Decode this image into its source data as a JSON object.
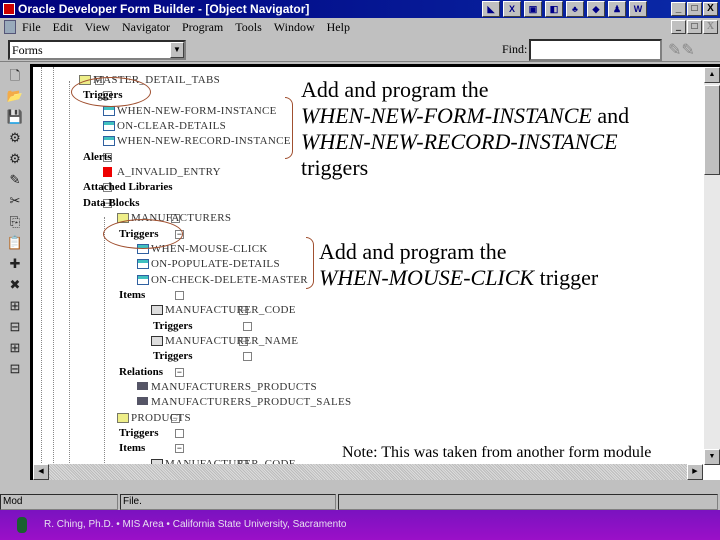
{
  "window": {
    "title": "Oracle Developer Form Builder - [Object Navigator]",
    "controls": [
      "_",
      "□",
      "X"
    ]
  },
  "taskbar_icons": [
    "xmouse",
    "excel",
    "screen",
    "explorer",
    "tools",
    "paint",
    "snag",
    "word"
  ],
  "menu": [
    "File",
    "Edit",
    "View",
    "Navigator",
    "Program",
    "Tools",
    "Window",
    "Help"
  ],
  "toolbar": {
    "combo_value": "Forms",
    "find_label": "Find:",
    "find_value": ""
  },
  "tree": [
    {
      "label": "MASTER_DETAIL_TABS",
      "level": 0,
      "box": "-",
      "icon": "block",
      "style": "faint"
    },
    {
      "label": "Triggers",
      "level": 1,
      "box": "",
      "style": "bold"
    },
    {
      "label": "WHEN-NEW-FORM-INSTANCE",
      "level": 2,
      "icon": "trig",
      "style": "faint"
    },
    {
      "label": "ON-CLEAR-DETAILS",
      "level": 2,
      "icon": "trig",
      "style": "faint"
    },
    {
      "label": "WHEN-NEW-RECORD-INSTANCE",
      "level": 2,
      "icon": "trig",
      "style": "faint"
    },
    {
      "label": "Alerts",
      "level": 1,
      "box": "-",
      "style": "bold"
    },
    {
      "label": "A_INVALID_ENTRY",
      "level": 2,
      "icon": "flag",
      "style": "faint"
    },
    {
      "label": "Attached Libraries",
      "level": 1,
      "box": "",
      "style": "bold"
    },
    {
      "label": "Data Blocks",
      "level": 1,
      "box": "-",
      "style": "bold"
    },
    {
      "label": "MANUFACTURERS",
      "level": 2,
      "box": "-",
      "icon": "block",
      "style": "faint"
    },
    {
      "label": "Triggers",
      "level": 3,
      "box": "-",
      "style": "bold"
    },
    {
      "label": "WHEN-MOUSE-CLICK",
      "level": 4,
      "icon": "trig",
      "style": "faint"
    },
    {
      "label": "ON-POPULATE-DETAILS",
      "level": 4,
      "icon": "trig",
      "style": "faint"
    },
    {
      "label": "ON-CHECK-DELETE-MASTER",
      "level": 4,
      "icon": "trig",
      "style": "faint"
    },
    {
      "label": "Items",
      "level": 3,
      "box": "",
      "style": "bold"
    },
    {
      "label": "MANUFACTURER_CODE",
      "level": 4,
      "box": "-",
      "icon": "item",
      "style": "faint"
    },
    {
      "label": "Triggers",
      "level": 5,
      "box": "",
      "style": "bold"
    },
    {
      "label": "MANUFACTURER_NAME",
      "level": 4,
      "box": "-",
      "icon": "item",
      "style": "faint"
    },
    {
      "label": "Triggers",
      "level": 5,
      "box": "",
      "style": "bold"
    },
    {
      "label": "Relations",
      "level": 3,
      "box": "-",
      "style": "bold"
    },
    {
      "label": "MANUFACTURERS_PRODUCTS",
      "level": 4,
      "icon": "rel",
      "style": "faint"
    },
    {
      "label": "MANUFACTURERS_PRODUCT_SALES",
      "level": 4,
      "icon": "rel",
      "style": "faint"
    },
    {
      "label": "PRODUCTS",
      "level": 2,
      "box": "-",
      "icon": "block",
      "style": "faint"
    },
    {
      "label": "Triggers",
      "level": 3,
      "box": "",
      "style": "bold"
    },
    {
      "label": "Items",
      "level": 3,
      "box": "-",
      "style": "bold"
    },
    {
      "label": "MANUFACTURER_CODE",
      "level": 4,
      "box": "-",
      "icon": "item",
      "style": "faint"
    }
  ],
  "annotations": {
    "a1_line1": "Add and program the",
    "a1_line2": "WHEN-NEW-FORM-INSTANCE",
    "a1_and": " and",
    "a1_line3": "WHEN-NEW-RECORD-INSTANCE",
    "a1_line4": "triggers",
    "a2_line1": "Add and program the",
    "a2_line2": "WHEN-MOUSE-CLICK",
    "a2_tail": " trigger",
    "note": "Note:  This was taken from another form module"
  },
  "status": {
    "mode": "Mod",
    "file": "File.",
    "extra": ""
  },
  "footer": {
    "text": "R. Ching, Ph.D. • MIS Area  • California State University, Sacramento"
  }
}
